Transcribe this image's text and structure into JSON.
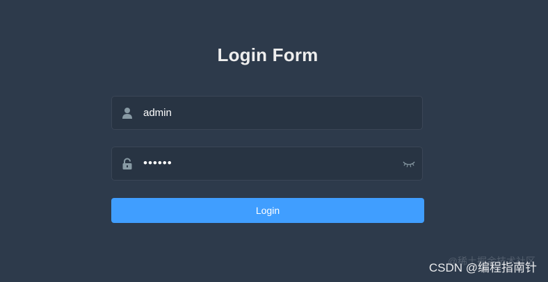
{
  "form": {
    "title": "Login Form",
    "username": {
      "value": "admin",
      "icon": "user-icon"
    },
    "password": {
      "masked_value": "••••••",
      "icon": "lock-icon",
      "toggle_icon": "eye-closed-icon"
    },
    "submit_label": "Login"
  },
  "watermark": {
    "text": "CSDN @编程指南针",
    "faint_text": "@稀土掘金技术社区"
  },
  "colors": {
    "background": "#2d3a4b",
    "field_background": "#283443",
    "accent": "#409eff",
    "icon": "#889aa4"
  }
}
